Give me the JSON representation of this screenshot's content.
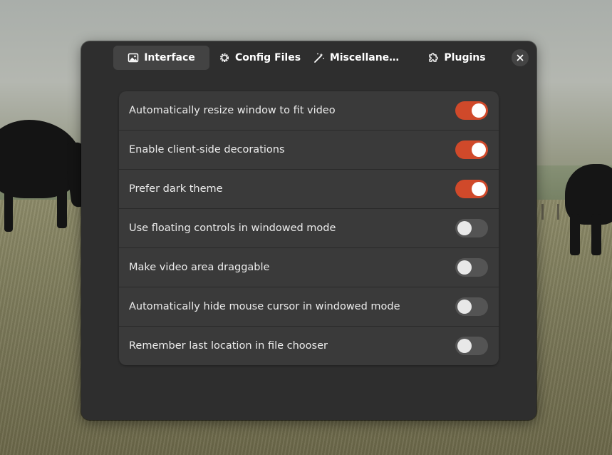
{
  "tabs": [
    {
      "label": "Interface",
      "icon": "image-icon",
      "active": true
    },
    {
      "label": "Config Files",
      "icon": "gear-icon",
      "active": false
    },
    {
      "label": "Miscellane…",
      "icon": "wand-icon",
      "active": false
    },
    {
      "label": "Plugins",
      "icon": "puzzle-icon",
      "active": false
    }
  ],
  "close_icon": "close-icon",
  "settings": [
    {
      "label": "Automatically resize window to fit video",
      "enabled": true
    },
    {
      "label": "Enable client-side decorations",
      "enabled": true
    },
    {
      "label": "Prefer dark theme",
      "enabled": true
    },
    {
      "label": "Use floating controls in windowed mode",
      "enabled": false
    },
    {
      "label": "Make video area draggable",
      "enabled": false
    },
    {
      "label": "Automatically hide mouse cursor in windowed mode",
      "enabled": false
    },
    {
      "label": "Remember last location in file chooser",
      "enabled": false
    }
  ],
  "colors": {
    "accent": "#d0492a",
    "dialog_bg": "#2e2e2e",
    "list_bg": "#3a3a3a",
    "switch_off": "#545454"
  }
}
